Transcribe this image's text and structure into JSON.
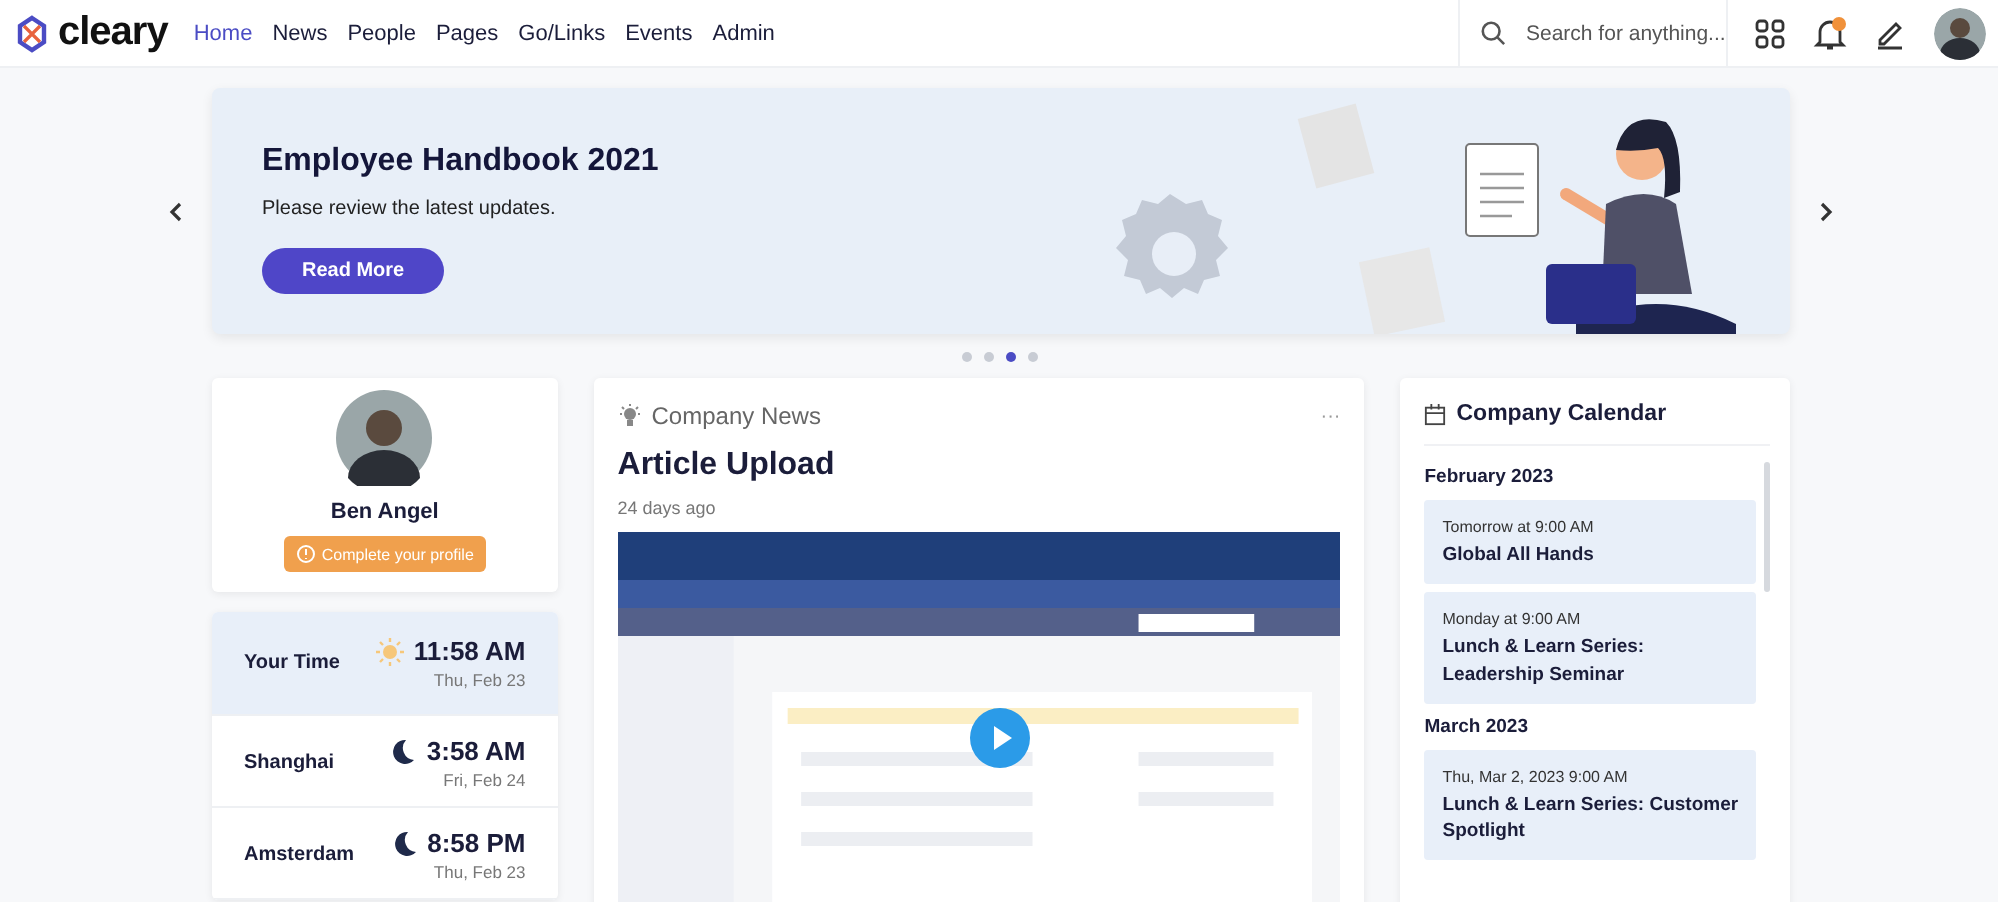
{
  "logo": {
    "text": "cleary"
  },
  "nav": [
    {
      "label": "Home",
      "selected": true
    },
    {
      "label": "News",
      "selected": false
    },
    {
      "label": "People",
      "selected": false
    },
    {
      "label": "Pages",
      "selected": false
    },
    {
      "label": "Go/Links",
      "selected": false
    },
    {
      "label": "Events",
      "selected": false
    },
    {
      "label": "Admin",
      "selected": false
    }
  ],
  "search": {
    "placeholder": "Search for anything..."
  },
  "banner": {
    "title": "Employee Handbook 2021",
    "subtitle": "Please review the latest updates.",
    "button": "Read More",
    "dots": [
      {
        "selected": false
      },
      {
        "selected": false
      },
      {
        "selected": true
      },
      {
        "selected": false
      }
    ]
  },
  "profile": {
    "name": "Ben Angel",
    "action": "Complete your profile"
  },
  "times": [
    {
      "label": "Your Time",
      "kind": "sun",
      "time": "11:58 AM",
      "date": "Thu, Feb 23",
      "highlighted": true
    },
    {
      "label": "Shanghai",
      "kind": "moon",
      "time": "3:58 AM",
      "date": "Fri, Feb 24",
      "highlighted": false
    },
    {
      "label": "Amsterdam",
      "kind": "moon",
      "time": "8:58 PM",
      "date": "Thu, Feb 23",
      "highlighted": false
    }
  ],
  "news": {
    "section": "Company News",
    "menu": "···",
    "title": "Article Upload",
    "age": "24 days ago"
  },
  "calendar": {
    "title": "Company Calendar",
    "groups": [
      {
        "month": "February 2023",
        "events": [
          {
            "when": "Tomorrow at 9:00 AM",
            "title": "Global All Hands"
          },
          {
            "when": "Monday at 9:00 AM",
            "title": "Lunch & Learn Series: Leadership Seminar"
          }
        ]
      },
      {
        "month": "March 2023",
        "events": [
          {
            "when": "Thu, Mar 2, 2023 9:00 AM",
            "title": "Lunch & Learn Series: Customer Spotlight"
          }
        ]
      }
    ]
  }
}
